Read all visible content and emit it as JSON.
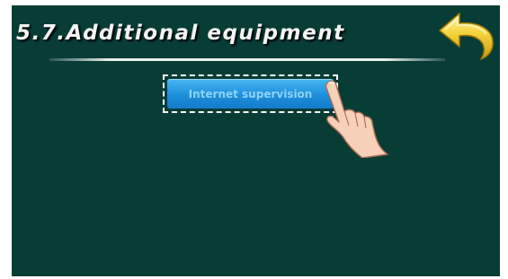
{
  "screen": {
    "title": "5.7.Additional equipment",
    "items": [
      {
        "label": "Internet supervision"
      }
    ]
  },
  "icons": {
    "back": "back-arrow-icon",
    "pointer": "pointing-hand-icon"
  },
  "colors": {
    "background": "#083d36",
    "button": "#1d8fdb",
    "back_arrow": "#f2cb2c"
  }
}
